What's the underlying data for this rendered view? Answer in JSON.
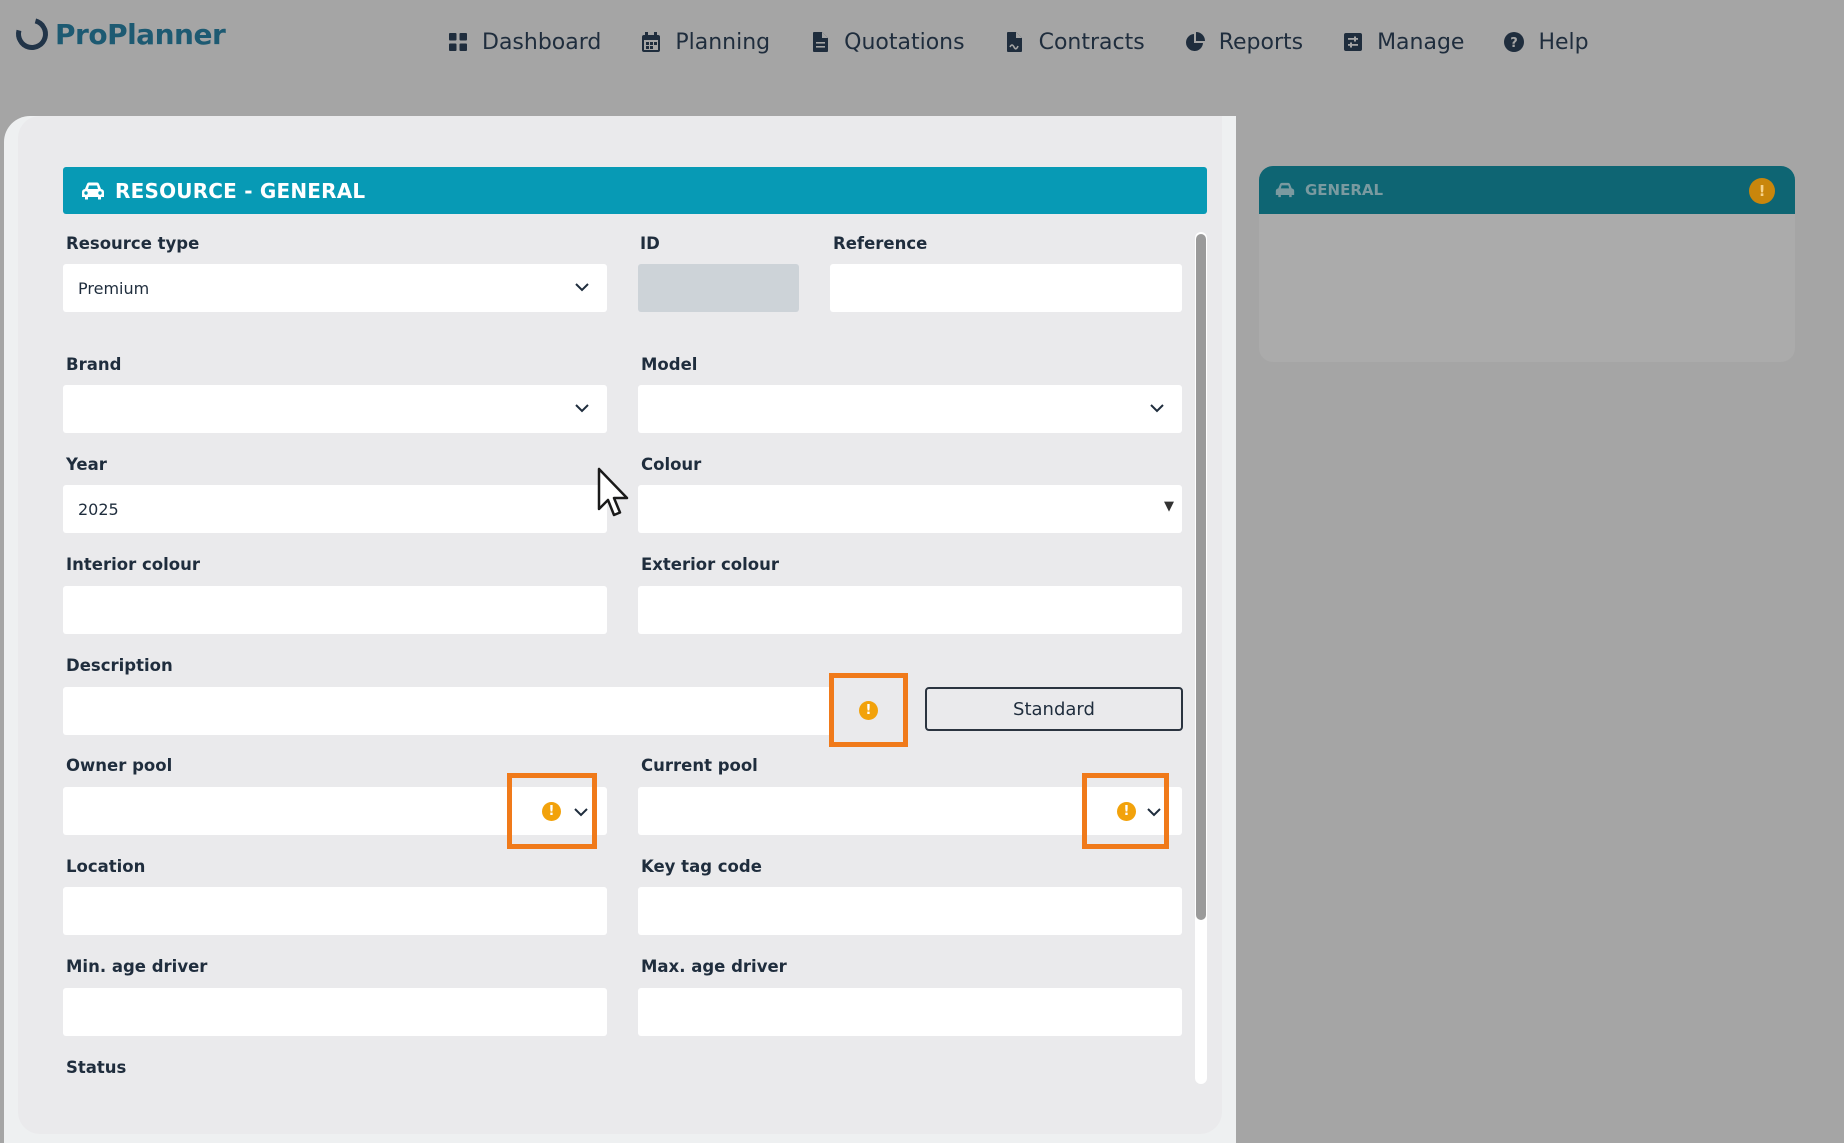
{
  "app": {
    "name": "ProPlanner"
  },
  "nav": [
    {
      "label": "Dashboard",
      "icon": "dashboard-icon"
    },
    {
      "label": "Planning",
      "icon": "calendar-icon"
    },
    {
      "label": "Quotations",
      "icon": "document-icon"
    },
    {
      "label": "Contracts",
      "icon": "contract-icon"
    },
    {
      "label": "Reports",
      "icon": "pie-chart-icon"
    },
    {
      "label": "Manage",
      "icon": "manage-icon"
    },
    {
      "label": "Help",
      "icon": "help-icon"
    }
  ],
  "section": {
    "title": "RESOURCE - GENERAL",
    "icon": "car-icon"
  },
  "form": {
    "resource_type": {
      "label": "Resource type",
      "value": "Premium"
    },
    "id": {
      "label": "ID",
      "value": ""
    },
    "reference": {
      "label": "Reference",
      "value": ""
    },
    "brand": {
      "label": "Brand",
      "value": ""
    },
    "model": {
      "label": "Model",
      "value": ""
    },
    "year": {
      "label": "Year",
      "value": "2025"
    },
    "colour": {
      "label": "Colour",
      "value": ""
    },
    "interior_colour": {
      "label": "Interior colour",
      "value": ""
    },
    "exterior_colour": {
      "label": "Exterior colour",
      "value": ""
    },
    "description": {
      "label": "Description",
      "value": ""
    },
    "standard_button": "Standard",
    "owner_pool": {
      "label": "Owner pool",
      "value": ""
    },
    "current_pool": {
      "label": "Current pool",
      "value": ""
    },
    "location": {
      "label": "Location",
      "value": ""
    },
    "key_tag_code": {
      "label": "Key tag code",
      "value": ""
    },
    "min_age_driver": {
      "label": "Min. age driver",
      "value": ""
    },
    "max_age_driver": {
      "label": "Max. age driver",
      "value": ""
    },
    "status": {
      "label": "Status"
    }
  },
  "warning_glyph": "!",
  "right_panel": {
    "title": "GENERAL",
    "icon": "car-icon"
  },
  "colors": {
    "accent": "#079ab5",
    "highlight": "#f07a1a",
    "warning": "#f2a20b",
    "topbar": "#a5a5a5"
  }
}
